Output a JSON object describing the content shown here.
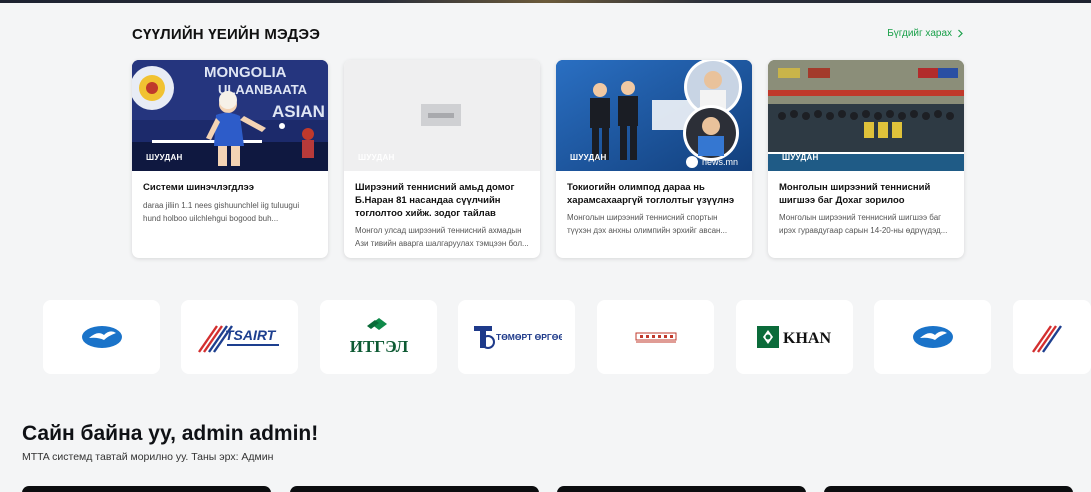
{
  "news": {
    "section_title": "СҮҮЛИЙН ҮЕИЙН МЭДЭЭ",
    "see_all_label": "Бүгдийг харах",
    "articles": [
      {
        "tag": "ШУУДАН",
        "title": "Системи шинэчлэгдлээ",
        "description": "daraa jiliin 1.1 nees gishuunchlel iig tuluugui hund holboo uilchlehgui bogood buh..."
      },
      {
        "tag": "ШУУДАН",
        "title": "Ширээний теннисний амьд домог Б.Наран 81 насандаа сүүлчийн тоглолтоо хийж. зодог тайлав",
        "description": "Монгол улсад ширээний теннисний ахмадын Ази тивийн аварга шалгаруулах тэмцээн бол..."
      },
      {
        "tag": "ШУУДАН",
        "title": "Токиогийн олимпод дараа нь харамсахааргүй тоглолтыг үзүүлнэ",
        "description": "Монголын ширээний теннисний спортын түүхэн дэх анхны олимпийн эрхийг авсан..."
      },
      {
        "tag": "ШУУДАН",
        "title": "Монголын ширээний теннисний шигшээ баг Дохаг зорилоо",
        "description": "Монголын ширээний теннисний шигшээ баг ирэх гуравдугаар сарын 14-20-ны өдрүүдэд..."
      }
    ],
    "image_texts": {
      "mongolia_banner": "MONGOLIA",
      "ulaanbaatar_banner": "ULAANBAATA",
      "asian_banner": "ASIAN",
      "news_watermark": "news.mn"
    }
  },
  "partners": [
    {
      "name": "eagle-logo"
    },
    {
      "name": "tsairt",
      "text": "TSAIRT"
    },
    {
      "name": "itgel",
      "text": "ИТГЭЛ"
    },
    {
      "name": "tomort-orgoo",
      "text": "ТӨМӨРТ ӨРГӨӨ ХХК"
    },
    {
      "name": "red-logo"
    },
    {
      "name": "khan",
      "text": "KHAN"
    },
    {
      "name": "eagle-logo"
    },
    {
      "name": "tsairt-partial"
    }
  ],
  "welcome": {
    "greeting": "Сайн байна уу, admin admin!",
    "subtitle": "MTTA системд тавтай морилно уу. Таны эрх: Админ"
  },
  "colors": {
    "accent_green": "#1aa04a",
    "page_bg": "#f4f5f6"
  }
}
